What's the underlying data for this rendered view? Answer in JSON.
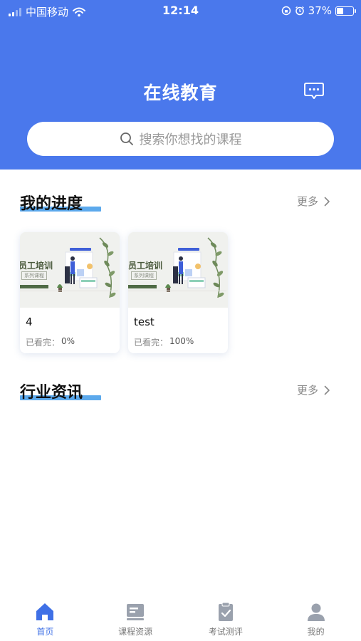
{
  "status_bar": {
    "carrier": "中国移动",
    "time": "12:14",
    "battery": "37%",
    "battery_level": 0.37
  },
  "header": {
    "title": "在线教育",
    "search_placeholder": "搜索你想找的课程"
  },
  "progress_section": {
    "title": "我的进度",
    "more": "更多",
    "courses": [
      {
        "name": "4",
        "watched_label": "已看完：",
        "percent": "0%",
        "thumb_title": "员工培训",
        "thumb_sub": "系列课程"
      },
      {
        "name": "test",
        "watched_label": "已看完：",
        "percent": "100%",
        "thumb_title": "员工培训",
        "thumb_sub": "系列课程"
      }
    ]
  },
  "news_section": {
    "title": "行业资讯",
    "more": "更多"
  },
  "tabbar": {
    "tabs": [
      {
        "label": "首页",
        "icon": "home-icon",
        "active": true
      },
      {
        "label": "课程资源",
        "icon": "course-icon",
        "active": false
      },
      {
        "label": "考试测评",
        "icon": "exam-icon",
        "active": false
      },
      {
        "label": "我的",
        "icon": "user-icon",
        "active": false
      }
    ]
  },
  "colors": {
    "brand": "#4a78ec",
    "accent_underline": "#4aa0ea",
    "tab_active": "#3f70e6",
    "tab_inactive": "#9aa1ad"
  }
}
